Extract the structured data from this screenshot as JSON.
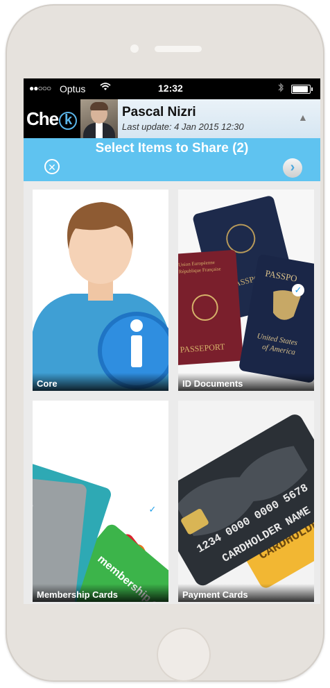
{
  "status_bar": {
    "signal": "●●○○○",
    "carrier": "Optus",
    "wifi_icon": "wifi-icon",
    "time": "12:32",
    "bluetooth_icon": "bluetooth-icon",
    "battery_level": 0.9
  },
  "header": {
    "logo_text_start": "Che",
    "logo_text_ring": "k",
    "logo_text_end": "k",
    "user_name": "Pascal Nizri",
    "last_update": "Last update: 4 Jan 2015 12:30",
    "collapse_icon": "triangle-up-icon"
  },
  "selection_bar": {
    "title": "Select Items to Share (2)",
    "close_icon": "close-circle-icon",
    "next_icon": "chevron-right-icon"
  },
  "tiles": [
    {
      "label": "Core",
      "selected": false
    },
    {
      "label": "ID Documents",
      "selected": true
    },
    {
      "label": "Membership Cards",
      "selected": true
    },
    {
      "label": "Payment Cards",
      "selected": false
    }
  ],
  "passport_text": {
    "passport_left": "PASSEPORT",
    "passport_top": "PASSPORT",
    "passport_right": "PASSPO",
    "usa_line1": "United States",
    "usa_line2": "of America",
    "eu_line1": "Union Européenne",
    "eu_line2": "République Française"
  },
  "membership_text": {
    "card": "membership card"
  },
  "payment_text": {
    "number": "1234 0000 0000 5678",
    "holder": "CARDHOLDER NAME"
  },
  "colors": {
    "accent": "#5fc3f0",
    "logo_ring": "#5bb6ea",
    "check": "#1e9ee8"
  }
}
